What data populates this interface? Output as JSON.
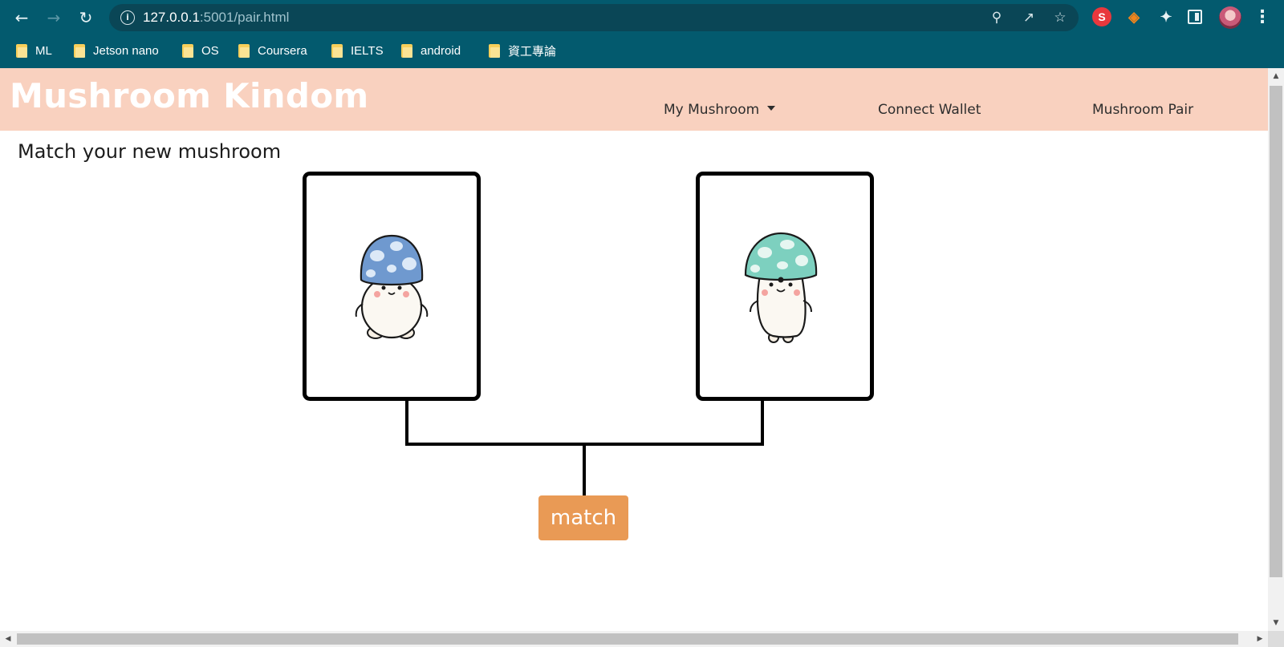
{
  "browser": {
    "url_host": "127.0.0.1",
    "url_rest": ":5001/pair.html",
    "bookmarks": [
      "ML",
      "Jetson nano",
      "OS",
      "Coursera",
      "IELTS",
      "android",
      "資工專論"
    ],
    "extension_s_label": "S"
  },
  "navbar": {
    "brand": "Mushroom Kindom",
    "links": [
      "My Mushroom",
      "Connect Wallet",
      "Mushroom Pair"
    ]
  },
  "main": {
    "heading": "Match your new mushroom",
    "cards": [
      {
        "cap_color": "#6f99cf",
        "spot_color": "#dce9f7",
        "description": "blue-capped round mushroom"
      },
      {
        "cap_color": "#7dd0bf",
        "spot_color": "#e6f6f1",
        "description": "green-capped tall mushroom"
      }
    ],
    "match_button": "match",
    "match_button_color": "#e99a55"
  },
  "colors": {
    "chrome": "#035a6e",
    "navbar": "#f9d1bf"
  }
}
